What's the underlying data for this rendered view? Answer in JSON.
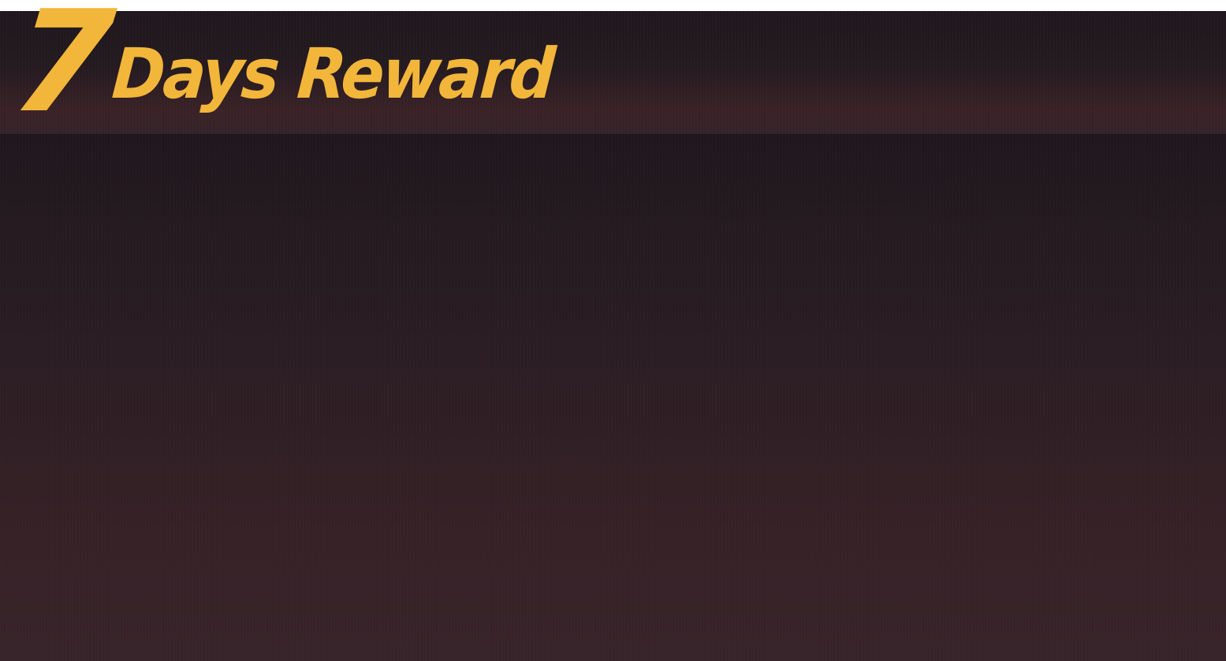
{
  "header": {
    "title_number": "7",
    "title_text": "Days Reward"
  },
  "colors": {
    "title": "#f2b63a",
    "background_top": "#1f171d",
    "background_bottom": "#37242a"
  }
}
